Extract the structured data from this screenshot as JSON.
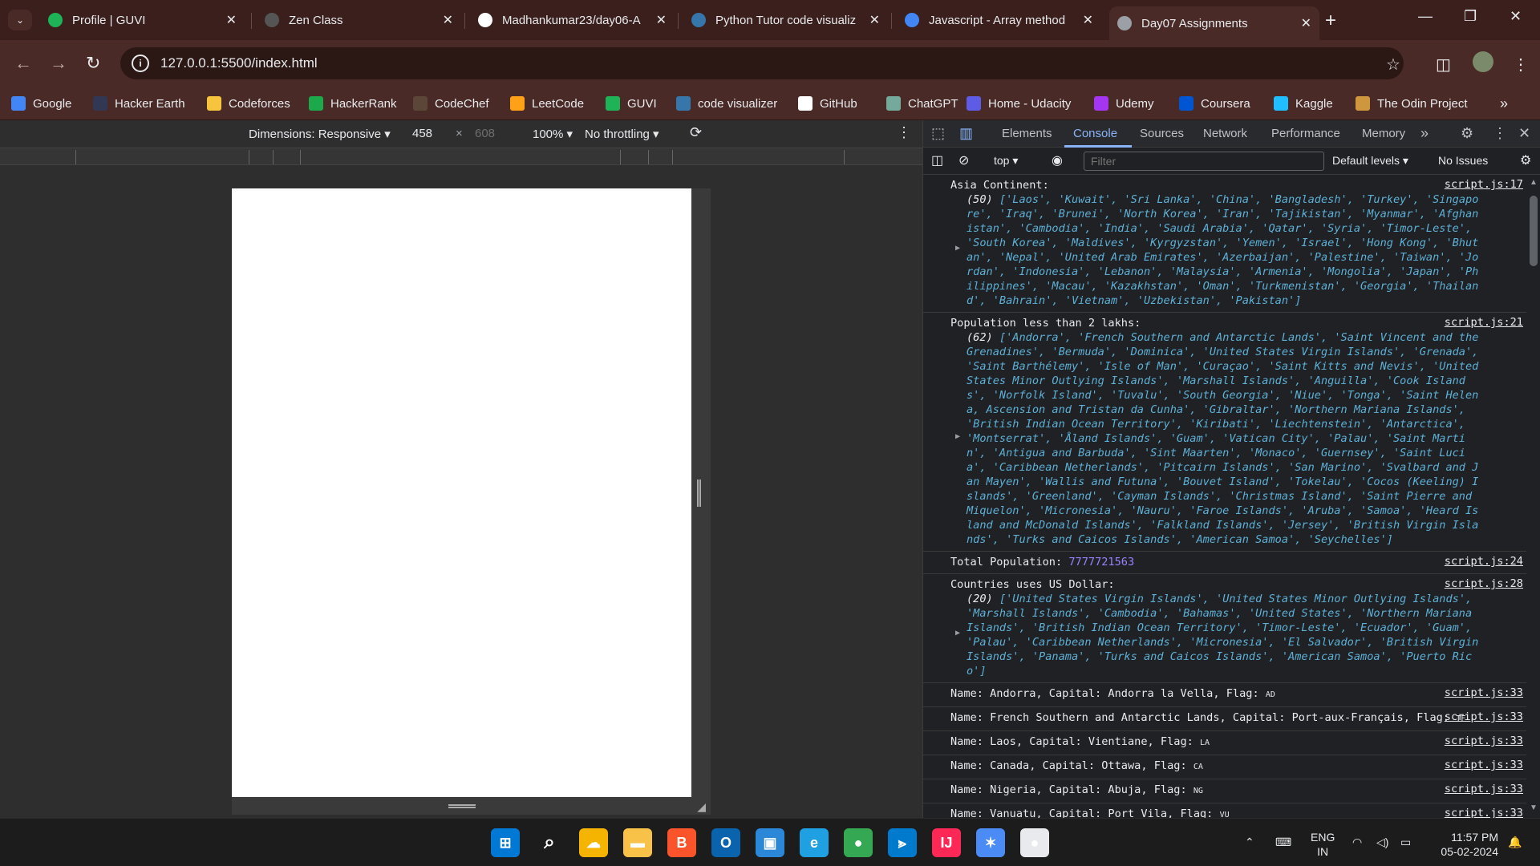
{
  "browser": {
    "tabs": [
      {
        "title": "Profile | GUVI",
        "icon": "guvi-icon",
        "color": "#1eb356"
      },
      {
        "title": "Zen Class",
        "icon": "zen-class-icon",
        "color": "#555555"
      },
      {
        "title": "Madhankumar23/day06-A",
        "icon": "github-icon",
        "color": "#ffffff"
      },
      {
        "title": "Python Tutor code visualiz",
        "icon": "python-icon",
        "color": "#3776ab"
      },
      {
        "title": "Javascript - Array method",
        "icon": "docs-icon",
        "color": "#4285f4"
      },
      {
        "title": "Day07 Assignments",
        "icon": "globe-icon",
        "color": "#9aa0a6"
      }
    ],
    "url": "127.0.0.1:5500/index.html",
    "bookmarks": [
      {
        "label": "Google",
        "icon": "google-icon",
        "color": "#4285f4"
      },
      {
        "label": "Hacker Earth",
        "icon": "hackerearth-icon",
        "color": "#323754"
      },
      {
        "label": "Codeforces",
        "icon": "codeforces-icon",
        "color": "#f6c43d"
      },
      {
        "label": "HackerRank",
        "icon": "hackerrank-icon",
        "color": "#1ba94c"
      },
      {
        "label": "CodeChef",
        "icon": "codechef-icon",
        "color": "#5b4638"
      },
      {
        "label": "LeetCode",
        "icon": "leetcode-icon",
        "color": "#ffa116"
      },
      {
        "label": "GUVI",
        "icon": "guvi-icon",
        "color": "#1eb356"
      },
      {
        "label": "code visualizer",
        "icon": "python-icon",
        "color": "#3776ab"
      },
      {
        "label": "GitHub",
        "icon": "github-icon",
        "color": "#ffffff"
      },
      {
        "label": "ChatGPT",
        "icon": "chatgpt-icon",
        "color": "#74aa9c"
      },
      {
        "label": "Home - Udacity",
        "icon": "udacity-icon",
        "color": "#5e5ce6"
      },
      {
        "label": "Udemy",
        "icon": "udemy-icon",
        "color": "#a435f0"
      },
      {
        "label": "Coursera",
        "icon": "coursera-icon",
        "color": "#0056d2"
      },
      {
        "label": "Kaggle",
        "icon": "kaggle-icon",
        "color": "#20beff"
      },
      {
        "label": "The Odin Project",
        "icon": "odin-icon",
        "color": "#ce973e"
      }
    ]
  },
  "device_toolbar": {
    "dimensions": "Dimensions: Responsive",
    "width": "458",
    "times": "×",
    "height": "608",
    "zoom": "100%",
    "throttling": "No throttling"
  },
  "devtools": {
    "tabs": [
      "Elements",
      "Console",
      "Sources",
      "Network",
      "Performance",
      "Memory"
    ],
    "context": "top",
    "filter_placeholder": "Filter",
    "levels": "Default levels",
    "issues": "No Issues",
    "messages": [
      {
        "label": "Asia Continent:",
        "count": "(50)",
        "array": "['Laos', 'Kuwait', 'Sri Lanka', 'China', 'Bangladesh', 'Turkey', 'Singapore', 'Iraq', 'Brunei', 'North Korea', 'Iran', 'Tajikistan', 'Myanmar', 'Afghanistan', 'Cambodia', 'India', 'Saudi Arabia', 'Qatar', 'Syria', 'Timor-Leste', 'South Korea', 'Maldives', 'Kyrgyzstan', 'Yemen', 'Israel', 'Hong Kong', 'Bhutan', 'Nepal', 'United Arab Emirates', 'Azerbaijan', 'Palestine', 'Taiwan', 'Jordan', 'Indonesia', 'Lebanon', 'Malaysia', 'Armenia', 'Mongolia', 'Japan', 'Philippines', 'Macau', 'Kazakhstan', 'Oman', 'Turkmenistan', 'Georgia', 'Thailand', 'Bahrain', 'Vietnam', 'Uzbekistan', 'Pakistan']",
        "src": "script.js:17"
      },
      {
        "label": "Population less than 2 lakhs:",
        "count": "(62)",
        "array": "['Andorra', 'French Southern and Antarctic Lands', 'Saint Vincent and the Grenadines', 'Bermuda', 'Dominica', 'United States Virgin Islands', 'Grenada', 'Saint Barthélemy', 'Isle of Man', 'Curaçao', 'Saint Kitts and Nevis', 'United States Minor Outlying Islands', 'Marshall Islands', 'Anguilla', 'Cook Islands', 'Norfolk Island', 'Tuvalu', 'South Georgia', 'Niue', 'Tonga', 'Saint Helena, Ascension and Tristan da Cunha', 'Gibraltar', 'Northern Mariana Islands', 'British Indian Ocean Territory', 'Kiribati', 'Liechtenstein', 'Antarctica', 'Montserrat', 'Åland Islands', 'Guam', 'Vatican City', 'Palau', 'Saint Martin', 'Antigua and Barbuda', 'Sint Maarten', 'Monaco', 'Guernsey', 'Saint Lucia', 'Caribbean Netherlands', 'Pitcairn Islands', 'San Marino', 'Svalbard and Jan Mayen', 'Wallis and Futuna', 'Bouvet Island', 'Tokelau', 'Cocos (Keeling) Islands', 'Greenland', 'Cayman Islands', 'Christmas Island', 'Saint Pierre and Miquelon', 'Micronesia', 'Nauru', 'Faroe Islands', 'Aruba', 'Samoa', 'Heard Island and McDonald Islands', 'Falkland Islands', 'Jersey', 'British Virgin Islands', 'Turks and Caicos Islands', 'American Samoa', 'Seychelles']",
        "src": "script.js:21"
      },
      {
        "label": "Total Population:",
        "number": "7777721563",
        "src": "script.js:24"
      },
      {
        "label": "Countries uses US Dollar:",
        "count": "(20)",
        "array": "['United States Virgin Islands', 'United States Minor Outlying Islands', 'Marshall Islands', 'Cambodia', 'Bahamas', 'United States', 'Northern Mariana Islands', 'British Indian Ocean Territory', 'Timor-Leste', 'Ecuador', 'Guam', 'Palau', 'Caribbean Netherlands', 'Micronesia', 'El Salvador', 'British Virgin Islands', 'Panama', 'Turks and Caicos Islands', 'American Samoa', 'Puerto Rico']",
        "src": "script.js:28"
      },
      {
        "label": "Name: Andorra, Capital: Andorra la Vella, Flag:",
        "flag": "AD",
        "src": "script.js:33"
      },
      {
        "label": "Name: French Southern and Antarctic Lands, Capital: Port-aux-Français, Flag:",
        "flag": "TF",
        "src": "script.js:33"
      },
      {
        "label": "Name: Laos, Capital: Vientiane, Flag:",
        "flag": "LA",
        "src": "script.js:33"
      },
      {
        "label": "Name: Canada, Capital: Ottawa, Flag:",
        "flag": "CA",
        "src": "script.js:33"
      },
      {
        "label": "Name: Nigeria, Capital: Abuja, Flag:",
        "flag": "NG",
        "src": "script.js:33"
      },
      {
        "label": "Name: Vanuatu, Capital: Port Vila, Flag:",
        "flag": "VU",
        "src": "script.js:33"
      }
    ]
  },
  "taskbar": {
    "apps": [
      "windows-start-icon",
      "search-icon",
      "widgets-icon",
      "file-explorer-icon",
      "brave-icon",
      "outlook-icon",
      "microsoft-store-icon",
      "edge-icon",
      "chrome-icon",
      "vscode-icon",
      "intellij-icon",
      "copilot-icon",
      "chrome-canary-icon"
    ],
    "language_line1": "ENG",
    "language_line2": "IN",
    "time": "11:57 PM",
    "date": "05-02-2024"
  }
}
